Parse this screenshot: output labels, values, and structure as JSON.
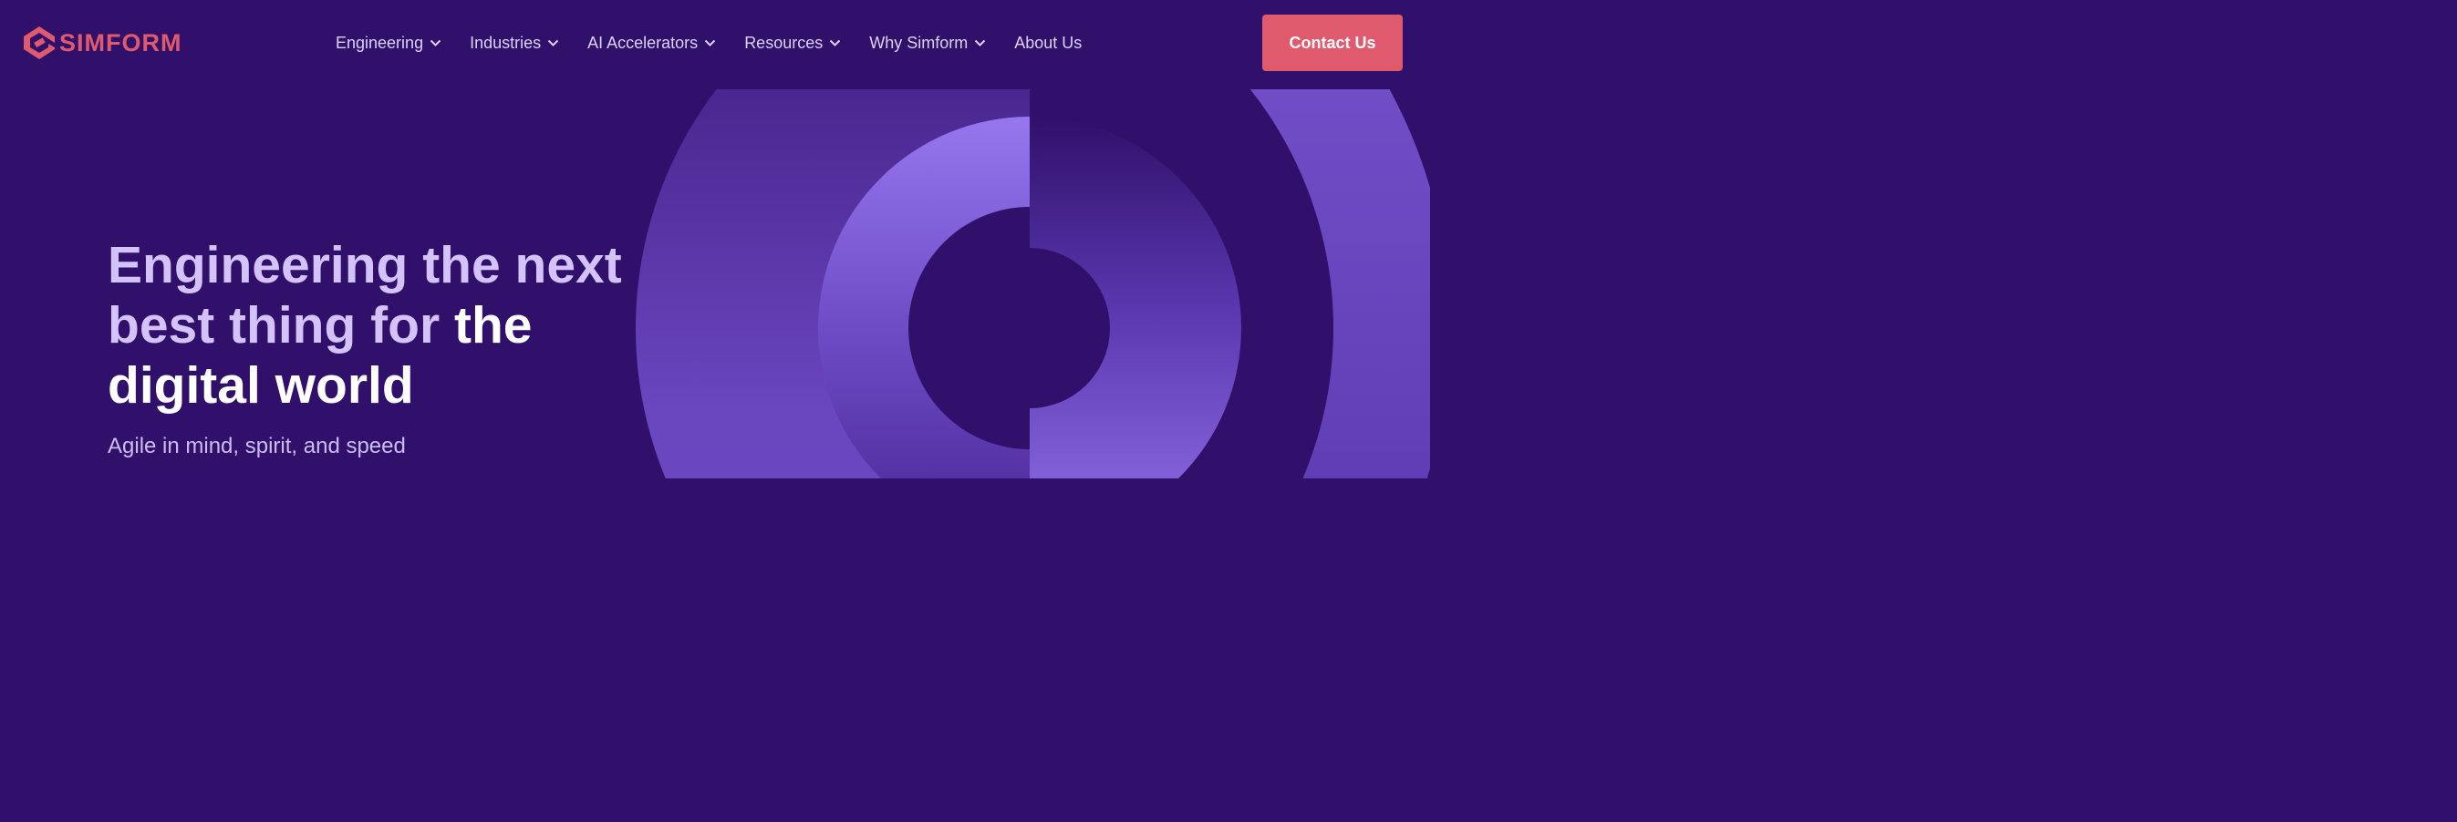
{
  "brand": {
    "name": "SIMFORM",
    "logo_icon": "simform-diamond-logo-icon",
    "color": "#e05a6d"
  },
  "nav": {
    "items": [
      {
        "label": "Engineering",
        "has_dropdown": true
      },
      {
        "label": "Industries",
        "has_dropdown": true
      },
      {
        "label": "AI Accelerators",
        "has_dropdown": true
      },
      {
        "label": "Resources",
        "has_dropdown": true
      },
      {
        "label": "Why Simform",
        "has_dropdown": true
      },
      {
        "label": "About Us",
        "has_dropdown": false
      }
    ],
    "dropdown_icon": "chevron-down-icon"
  },
  "cta": {
    "label": "Contact Us",
    "color": "#e05a6d"
  },
  "hero": {
    "title_part1": "Engineering the next best thing for ",
    "title_part2": "the digital world",
    "subtitle": "Agile in mind, spirit, and speed"
  },
  "colors": {
    "background": "#30106a",
    "accent_purple": "#8f6fe8",
    "text_lavender": "#d4c3f8"
  }
}
